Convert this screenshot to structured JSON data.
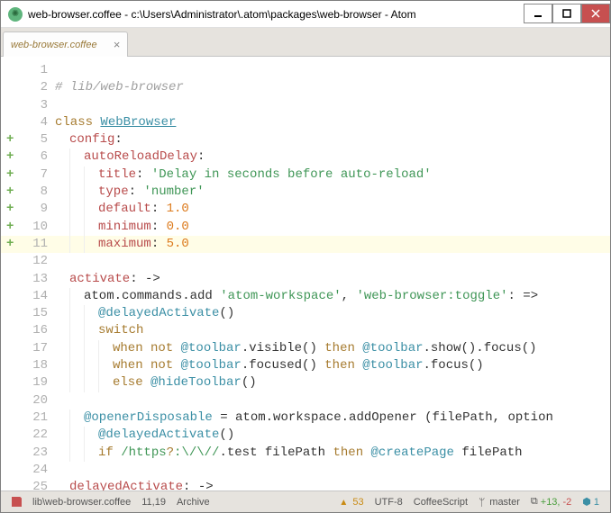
{
  "window": {
    "title": "web-browser.coffee - c:\\Users\\Administrator\\.atom\\packages\\web-browser - Atom"
  },
  "tab": {
    "title": "web-browser.coffee",
    "modified": true
  },
  "code": {
    "highlighted_line": 11,
    "lines": [
      {
        "n": 1,
        "added": false,
        "tokens": []
      },
      {
        "n": 2,
        "added": false,
        "tokens": [
          {
            "cls": "c-comment",
            "text": "# lib/web-browser"
          }
        ]
      },
      {
        "n": 3,
        "added": false,
        "tokens": []
      },
      {
        "n": 4,
        "added": false,
        "tokens": [
          {
            "cls": "c-class",
            "text": "class "
          },
          {
            "cls": "c-name",
            "text": "WebBrowser"
          }
        ]
      },
      {
        "n": 5,
        "added": true,
        "indent": 1,
        "tokens": [
          {
            "cls": "c-prop",
            "text": "config"
          },
          {
            "cls": "c-punc",
            "text": ":"
          }
        ]
      },
      {
        "n": 6,
        "added": true,
        "indent": 2,
        "tokens": [
          {
            "cls": "c-prop",
            "text": "autoReloadDelay"
          },
          {
            "cls": "c-punc",
            "text": ":"
          }
        ]
      },
      {
        "n": 7,
        "added": true,
        "indent": 3,
        "tokens": [
          {
            "cls": "c-prop",
            "text": "title"
          },
          {
            "cls": "c-punc",
            "text": ": "
          },
          {
            "cls": "c-str",
            "text": "'Delay in seconds before auto-reload'"
          }
        ]
      },
      {
        "n": 8,
        "added": true,
        "indent": 3,
        "tokens": [
          {
            "cls": "c-prop",
            "text": "type"
          },
          {
            "cls": "c-punc",
            "text": ": "
          },
          {
            "cls": "c-str",
            "text": "'number'"
          }
        ]
      },
      {
        "n": 9,
        "added": true,
        "indent": 3,
        "tokens": [
          {
            "cls": "c-prop",
            "text": "default"
          },
          {
            "cls": "c-punc",
            "text": ": "
          },
          {
            "cls": "c-num",
            "text": "1.0"
          }
        ]
      },
      {
        "n": 10,
        "added": true,
        "indent": 3,
        "tokens": [
          {
            "cls": "c-prop",
            "text": "minimum"
          },
          {
            "cls": "c-punc",
            "text": ": "
          },
          {
            "cls": "c-num",
            "text": "0.0"
          }
        ]
      },
      {
        "n": 11,
        "added": true,
        "indent": 3,
        "tokens": [
          {
            "cls": "c-prop",
            "text": "maximum"
          },
          {
            "cls": "c-punc",
            "text": ": "
          },
          {
            "cls": "c-num",
            "text": "5.0"
          }
        ]
      },
      {
        "n": 12,
        "added": false,
        "tokens": []
      },
      {
        "n": 13,
        "added": false,
        "indent": 1,
        "tokens": [
          {
            "cls": "c-prop",
            "text": "activate"
          },
          {
            "cls": "c-punc",
            "text": ": ->"
          }
        ]
      },
      {
        "n": 14,
        "added": false,
        "indent": 2,
        "tokens": [
          {
            "cls": "c-punc",
            "text": "atom.commands.add "
          },
          {
            "cls": "c-str",
            "text": "'atom-workspace'"
          },
          {
            "cls": "c-punc",
            "text": ", "
          },
          {
            "cls": "c-str",
            "text": "'web-browser:toggle'"
          },
          {
            "cls": "c-punc",
            "text": ": =>"
          }
        ]
      },
      {
        "n": 15,
        "added": false,
        "indent": 3,
        "tokens": [
          {
            "cls": "c-this",
            "text": "@delayedActivate"
          },
          {
            "cls": "c-punc",
            "text": "()"
          }
        ]
      },
      {
        "n": 16,
        "added": false,
        "indent": 3,
        "tokens": [
          {
            "cls": "c-kw",
            "text": "switch"
          }
        ]
      },
      {
        "n": 17,
        "added": false,
        "indent": 4,
        "tokens": [
          {
            "cls": "c-kw",
            "text": "when not "
          },
          {
            "cls": "c-this",
            "text": "@toolbar"
          },
          {
            "cls": "c-punc",
            "text": ".visible() "
          },
          {
            "cls": "c-kw",
            "text": "then "
          },
          {
            "cls": "c-this",
            "text": "@toolbar"
          },
          {
            "cls": "c-punc",
            "text": ".show().focus()"
          }
        ]
      },
      {
        "n": 18,
        "added": false,
        "indent": 4,
        "tokens": [
          {
            "cls": "c-kw",
            "text": "when not "
          },
          {
            "cls": "c-this",
            "text": "@toolbar"
          },
          {
            "cls": "c-punc",
            "text": ".focused() "
          },
          {
            "cls": "c-kw",
            "text": "then "
          },
          {
            "cls": "c-this",
            "text": "@toolbar"
          },
          {
            "cls": "c-punc",
            "text": ".focus()"
          }
        ]
      },
      {
        "n": 19,
        "added": false,
        "indent": 4,
        "tokens": [
          {
            "cls": "c-kw",
            "text": "else "
          },
          {
            "cls": "c-this",
            "text": "@hideToolbar"
          },
          {
            "cls": "c-punc",
            "text": "()"
          }
        ]
      },
      {
        "n": 20,
        "added": false,
        "tokens": []
      },
      {
        "n": 21,
        "added": false,
        "indent": 2,
        "tokens": [
          {
            "cls": "c-this",
            "text": "@openerDisposable"
          },
          {
            "cls": "c-punc",
            "text": " = atom.workspace.addOpener (filePath, option"
          }
        ]
      },
      {
        "n": 22,
        "added": false,
        "indent": 3,
        "tokens": [
          {
            "cls": "c-this",
            "text": "@delayedActivate"
          },
          {
            "cls": "c-punc",
            "text": "()"
          }
        ]
      },
      {
        "n": 23,
        "added": false,
        "indent": 3,
        "tokens": [
          {
            "cls": "c-kw",
            "text": "if "
          },
          {
            "cls": "c-regex",
            "text": "/https"
          },
          {
            "cls": "c-kw",
            "text": "?"
          },
          {
            "cls": "c-regex",
            "text": ":\\/\\//"
          },
          {
            "cls": "c-punc",
            "text": ".test filePath "
          },
          {
            "cls": "c-kw",
            "text": "then "
          },
          {
            "cls": "c-this",
            "text": "@createPage"
          },
          {
            "cls": "c-punc",
            "text": " filePath"
          }
        ]
      },
      {
        "n": 24,
        "added": false,
        "tokens": []
      },
      {
        "n": 25,
        "added": false,
        "indent": 1,
        "tokens": [
          {
            "cls": "c-prop",
            "text": "delayedActivate"
          },
          {
            "cls": "c-punc",
            "text": ": ->"
          }
        ]
      }
    ]
  },
  "status": {
    "file": "lib\\web-browser.coffee",
    "cursor": "11,19",
    "archive": "Archive",
    "warnings": "53",
    "encoding": "UTF-8",
    "grammar": "CoffeeScript",
    "branch": "master",
    "diff_add": "+13,",
    "diff_del": "-2",
    "packages": "1"
  }
}
